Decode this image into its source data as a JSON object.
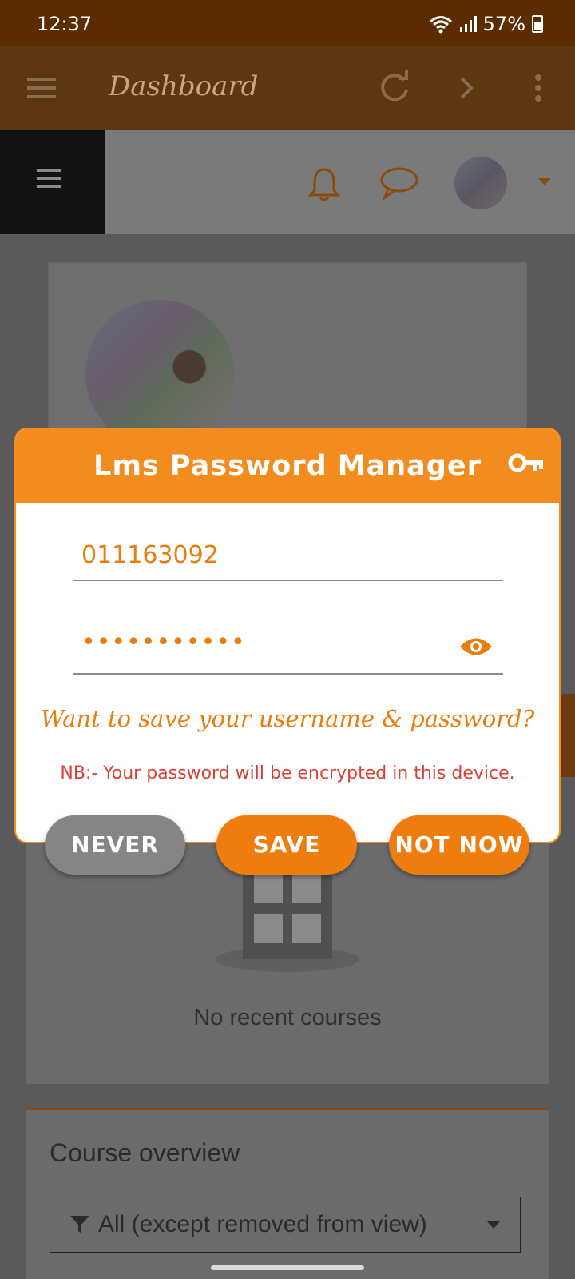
{
  "status_bar": {
    "time": "12:37",
    "battery": "57%"
  },
  "app_bar": {
    "title": "Dashboard"
  },
  "page": {
    "no_recent_courses": "No recent courses",
    "course_overview": "Course overview",
    "filter_label": "All (except removed from view)"
  },
  "dialog": {
    "title": "Lms Password Manager",
    "username_value": "011163092",
    "password_masked": "•••••••••••",
    "question": "Want to save your username & password?",
    "note": "NB:- Your password will be encrypted in this device.",
    "buttons": {
      "never": "NEVER",
      "save": "SAVE",
      "not_now": "NOT NOW"
    }
  },
  "colors": {
    "accent": "#f28c1e",
    "button_orange": "#ee7d0e",
    "button_gray": "#858585",
    "note_red": "#d94035"
  }
}
